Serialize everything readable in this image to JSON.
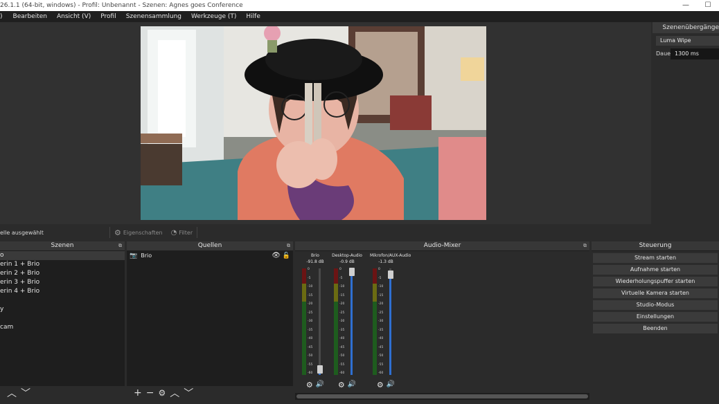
{
  "titlebar": {
    "title": "26.1.1 (64-bit, windows) - Profil: Unbenannt - Szenen: Agnes goes Conference",
    "minimize": "—",
    "maximize": "☐"
  },
  "menu": {
    "items": [
      ")",
      "Bearbeiten",
      "Ansicht (V)",
      "Profil",
      "Szenensammlung",
      "Werkzeuge (T)",
      "Hilfe"
    ]
  },
  "transitions": {
    "title": "Szenenübergänge",
    "selected": "Luma Wipe",
    "duration_label": "Dauer",
    "duration_value": "1300 ms"
  },
  "infobar": {
    "selection": "elle ausgewählt",
    "properties": "Eigenschaften",
    "filters": "Filter"
  },
  "scenes": {
    "title": "Szenen",
    "items": [
      "o",
      "erin 1 + Brio",
      "erin 2 + Brio",
      "erin 3 + Brio",
      "erin 4 + Brio",
      "",
      "y",
      "",
      "cam"
    ]
  },
  "sources": {
    "title": "Quellen",
    "items": [
      {
        "name": "Brio"
      }
    ]
  },
  "mixer": {
    "title": "Audio-Mixer",
    "ticks": [
      "0",
      "-5",
      "-10",
      "-15",
      "-20",
      "-25",
      "-30",
      "-35",
      "-40",
      "-45",
      "-50",
      "-55",
      "-60"
    ],
    "channels": [
      {
        "name": "Brio",
        "db": "-91.8 dB",
        "fader": 0.05
      },
      {
        "name": "Desktop-Audio",
        "db": "-0.9 dB",
        "fader": 0.97
      },
      {
        "name": "Mikrofon/AUX-Audio",
        "db": "-1.3 dB",
        "fader": 0.94
      }
    ]
  },
  "controls": {
    "title": "Steuerung",
    "buttons": [
      "Stream starten",
      "Aufnahme starten",
      "Wiederholungspuffer starten",
      "Virtuelle Kamera starten",
      "Studio-Modus",
      "Einstellungen",
      "Beenden"
    ]
  },
  "icons": {
    "float": "float-icon",
    "gear": "gear-icon",
    "speaker": "speaker-icon",
    "eye": "eye-icon",
    "lock": "lock-icon",
    "camera": "camera-icon"
  }
}
